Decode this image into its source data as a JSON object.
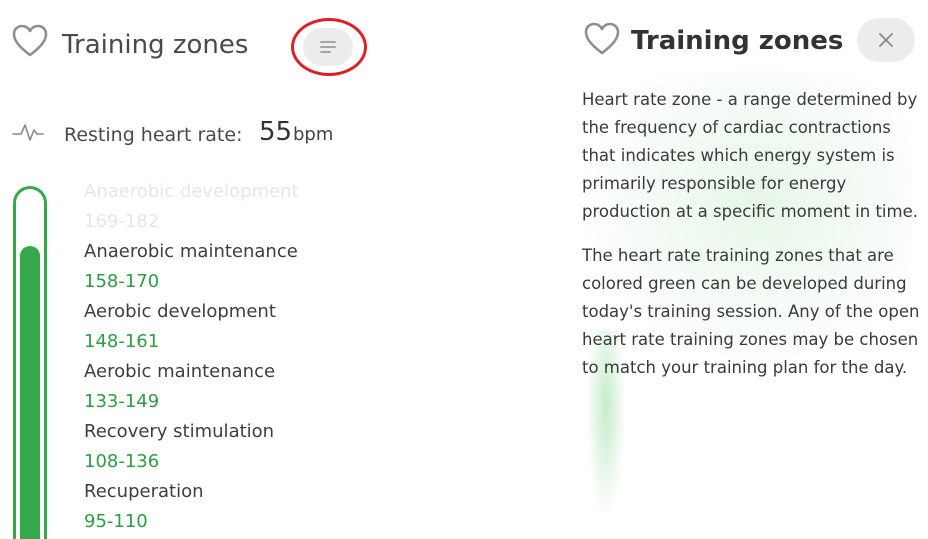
{
  "left_panel": {
    "title": "Training zones",
    "icons": {
      "favorite": "heart-outline-icon",
      "menu": "menu-lines-icon",
      "pulse": "pulse-icon"
    },
    "resting": {
      "label": "Resting heart rate:",
      "value": "55",
      "unit": "bpm"
    },
    "zones": [
      {
        "name": "Anaerobic development",
        "range": "169-182"
      },
      {
        "name": "Anaerobic maintenance",
        "range": "158-170"
      },
      {
        "name": "Aerobic development",
        "range": "148-161"
      },
      {
        "name": "Aerobic maintenance",
        "range": "133-149"
      },
      {
        "name": "Recovery stimulation",
        "range": "108-136"
      },
      {
        "name": "Recuperation",
        "range": "95-110"
      }
    ]
  },
  "right_panel": {
    "title": "Training zones",
    "icons": {
      "favorite": "heart-outline-icon",
      "close": "close-icon"
    },
    "paragraphs": [
      "Heart rate zone - a range determined by the frequency of cardiac contractions that indicates which energy system is primarily responsible for energy production at a specific moment in time.",
      "The heart rate training zones that are colored green can be developed during today's training session. Any of the open heart rate training zones may be chosen to match your training plan for the day."
    ]
  },
  "colors": {
    "green": "#34a84a",
    "zone_range_green": "#2e9d44",
    "highlight_red": "#e02020",
    "button_gray": "#ececec",
    "faded_text": "#e6e6e6"
  }
}
